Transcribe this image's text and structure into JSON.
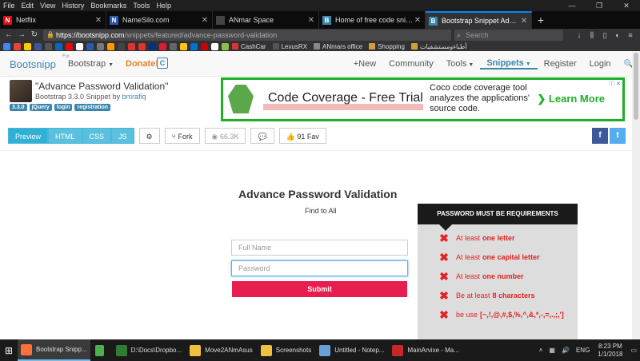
{
  "menu": [
    "File",
    "Edit",
    "View",
    "History",
    "Bookmarks",
    "Tools",
    "Help"
  ],
  "window_controls": [
    "—",
    "❐",
    "✕"
  ],
  "tabs": [
    {
      "label": "Netflix",
      "favcolor": "#e50914",
      "glyph": "N",
      "active": false
    },
    {
      "label": "NameSilo.com",
      "favcolor": "#2b5ba8",
      "glyph": "N",
      "active": false
    },
    {
      "label": "ANmar Space",
      "favcolor": "#444",
      "glyph": "",
      "active": false
    },
    {
      "label": "Home of free code snippets fo…",
      "favcolor": "#3a87ad",
      "glyph": "B",
      "active": false
    },
    {
      "label": "Bootstrap Snippet Advance Pa…",
      "favcolor": "#3a87ad",
      "glyph": "B",
      "active": true
    }
  ],
  "nav": {
    "url_host": "https://bootsnipp.com",
    "url_path": "/snippets/featured/advance-password-validation",
    "search_placeholder": "Search"
  },
  "bookmarks": [
    {
      "label": "CashCar",
      "color": "#d33"
    },
    {
      "label": "LexusRX",
      "color": "#555"
    },
    {
      "label": "ANmars office",
      "color": "#888"
    },
    {
      "label": "Shopping",
      "color": "#c9a33a"
    },
    {
      "label": "أطباءومستشفيات",
      "color": "#c9a33a"
    }
  ],
  "bookmark_icon_colors": [
    "#4285f4",
    "#ea4335",
    "#ffcc00",
    "#3b5998",
    "#555",
    "#0a66c2",
    "#e50914",
    "#fff",
    "#2b5ba8",
    "#777",
    "#ff9900",
    "#444",
    "#d33",
    "#d33",
    "#003087",
    "#e31837",
    "#666",
    "#ffc220",
    "#0071ce",
    "#cc0000",
    "#fff",
    "#8bc34a"
  ],
  "site": {
    "brand": "Bootsnipp",
    "for_label": "For",
    "bootstrap_label": "Bootstrap",
    "donate_label": "Donate!",
    "c_badge": "C",
    "links": [
      {
        "label": "+New",
        "style": ""
      },
      {
        "label": "Community",
        "style": ""
      },
      {
        "label": "Tools",
        "style": "caret"
      },
      {
        "label": "Snippets",
        "style": "blue-active-caret"
      },
      {
        "label": "Register",
        "style": ""
      },
      {
        "label": "Login",
        "style": ""
      }
    ],
    "search_icon": "search-icon"
  },
  "snippet": {
    "title": "\"Advance Password Validation\"",
    "subtitle_prefix": "Bootstrap 3.3.0 Snippet by ",
    "author": "bmrafiq",
    "tags": [
      "3.3.0",
      "jQuery",
      "login",
      "registration"
    ]
  },
  "ad": {
    "title": "Code Coverage - Free Trial",
    "body": "Coco code coverage tool analyzes the applications' source code.",
    "cta": "Learn More",
    "info": "ⓘ ✕"
  },
  "toolbar": {
    "tabs": [
      "Preview",
      "HTML",
      "CSS",
      "JS"
    ],
    "gear": "⚙",
    "fork": "Fork",
    "views": "66.3K",
    "comment": "💬",
    "fav": "91 Fav"
  },
  "social": {
    "fb": "f",
    "tw": "t"
  },
  "form": {
    "title": "Advance Password Validation",
    "subtitle": "Find to All",
    "fullname_placeholder": "Full Name",
    "password_placeholder": "Password",
    "submit_label": "Submit"
  },
  "requirements": {
    "heading": "PASSWORD MUST BE REQUIREMENTS",
    "items": [
      {
        "prefix": "At least",
        "bold": "one letter"
      },
      {
        "prefix": "At least",
        "bold": "one capital letter"
      },
      {
        "prefix": "At least",
        "bold": "one number"
      },
      {
        "prefix": "Be at least",
        "bold": "8 characters"
      },
      {
        "prefix": "be use",
        "bold": "[~,!,@,#,$,%,^,&,*,-,=,.,;,']"
      }
    ]
  },
  "taskbar": {
    "items": [
      {
        "label": "Bootstrap Snipp...",
        "color": "#ff7139",
        "active": true
      },
      {
        "label": "",
        "color": "#4caf50",
        "active": false
      },
      {
        "label": "D:\\Docs\\Dropbo...",
        "color": "#2e7d32",
        "active": false
      },
      {
        "label": "Move2ANmAsus",
        "color": "#f0c040",
        "active": false
      },
      {
        "label": "Screenshots",
        "color": "#f0c040",
        "active": false
      },
      {
        "label": "Untitled - Notep...",
        "color": "#6aa0d8",
        "active": false
      },
      {
        "label": "MainArvixe - Ma...",
        "color": "#c62828",
        "active": false
      }
    ],
    "lang": "ENG",
    "time": "8:23 PM",
    "date": "1/1/2018"
  }
}
